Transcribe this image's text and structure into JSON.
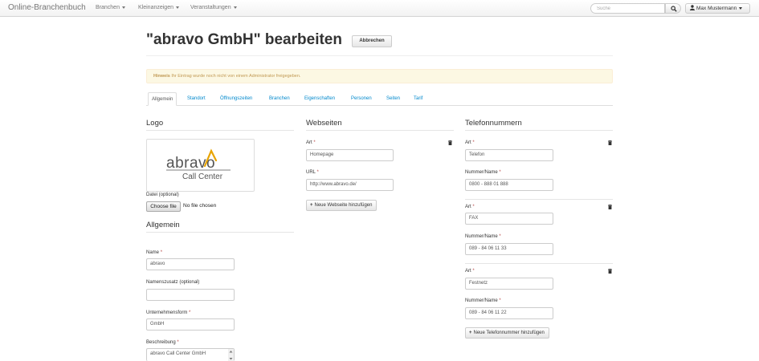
{
  "navbar": {
    "brand": "Online-Branchenbuch",
    "menu": [
      {
        "label": "Branchen"
      },
      {
        "label": "Kleinanzeigen"
      },
      {
        "label": "Veranstaltungen"
      }
    ],
    "search_placeholder": "Suche",
    "user_label": "Max Mustermann"
  },
  "page": {
    "title": "\"abravo GmbH\" bearbeiten",
    "cancel_label": "Abbrechen"
  },
  "alert": {
    "strong": "Hinweis",
    "text": "Ihr Eintrag wurde noch nicht von einem Administrator freigegeben."
  },
  "tabs": [
    {
      "label": "Allgemein",
      "active": true
    },
    {
      "label": "Standort"
    },
    {
      "label": "Öffnungszeiten"
    },
    {
      "label": "Branchen"
    },
    {
      "label": "Eigenschaften"
    },
    {
      "label": "Personen"
    },
    {
      "label": "Seiten"
    },
    {
      "label": "Tarif"
    }
  ],
  "logo": {
    "section_title": "Logo",
    "logo_word": "abravo",
    "logo_sub": "Call Center",
    "file_label": "Datei (optional)",
    "choose_file": "Choose file",
    "no_file": "No file chosen"
  },
  "allgemein": {
    "section_title": "Allgemein",
    "required_mark": "*",
    "name_label": "Name",
    "name_value": "abravo",
    "zusatz_label": "Namenszusatz (optional)",
    "zusatz_value": "",
    "form_label": "Unternehmensform",
    "form_value": "GmbH",
    "desc_label": "Beschreibung",
    "desc_value": "abravo Call Center GmbH"
  },
  "webseiten": {
    "section_title": "Webseiten",
    "art_label": "Art",
    "art_value": "Homepage",
    "url_label": "URL",
    "url_value": "http://www.abravo.de/",
    "add_label": "Neue Webseite hinzufügen"
  },
  "telefon": {
    "section_title": "Telefonnummern",
    "art_label": "Art",
    "nummer_label": "Nummer/Name",
    "entries": [
      {
        "art": "Telefon",
        "nummer": "0800 - 888 01 888"
      },
      {
        "art": "FAX",
        "nummer": "089 - 84 06 11 33"
      },
      {
        "art": "Festnetz",
        "nummer": "089 - 84 06 11 22"
      }
    ],
    "add_label": "Neue Telefonnummer hinzufügen"
  },
  "colors": {
    "link": "#0088cc",
    "required": "#b94a48",
    "alert_bg": "#fcf8e3",
    "alert_text": "#c09853",
    "logo_gold": "#e8a400"
  }
}
